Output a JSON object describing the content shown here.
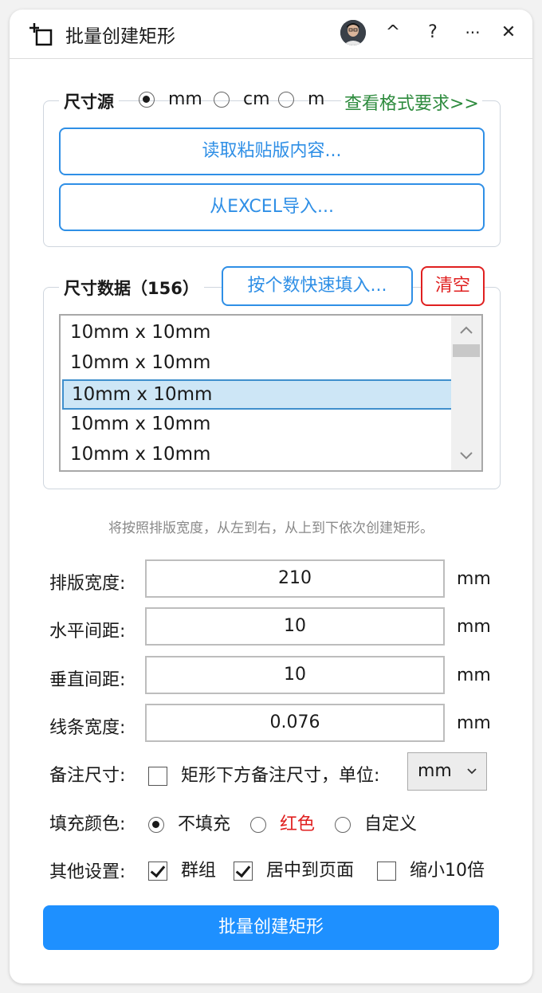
{
  "titlebar": {
    "title": "批量创建矩形",
    "icons": [
      "add-rectangle-icon",
      "user-avatar",
      "collapse-icon",
      "help-icon",
      "more-icon",
      "close-icon"
    ],
    "collapse_glyph": "^",
    "help_glyph": "?",
    "more_glyph": "···",
    "close_glyph": "✕"
  },
  "size_source": {
    "legend": "尺寸源",
    "units": [
      {
        "label": "mm",
        "selected": true
      },
      {
        "label": "cm",
        "selected": false
      },
      {
        "label": "m",
        "selected": false
      }
    ],
    "format_link": "查看格式要求>>",
    "read_clipboard": "读取粘贴版内容...",
    "import_excel": "从EXCEL导入..."
  },
  "size_data": {
    "legend": "尺寸数据（156）",
    "quick_fill": "按个数快速填入...",
    "clear": "清空",
    "items": [
      "10mm x 10mm",
      "10mm x 10mm",
      "10mm x 10mm",
      "10mm x 10mm",
      "10mm x 10mm"
    ],
    "selected_index": 2
  },
  "hint": "将按照排版宽度，从左到右，从上到下依次创建矩形。",
  "layout": {
    "width": {
      "label": "排版宽度:",
      "value": "210",
      "unit": "mm"
    },
    "h_gap": {
      "label": "水平间距:",
      "value": "10",
      "unit": "mm"
    },
    "v_gap": {
      "label": "垂直间距:",
      "value": "10",
      "unit": "mm"
    },
    "line_width": {
      "label": "线条宽度:",
      "value": "0.076",
      "unit": "mm"
    }
  },
  "annotation": {
    "label": "备注尺寸:",
    "checkbox_label": "矩形下方备注尺寸，单位:",
    "checked": false,
    "unit_select": "mm"
  },
  "fill": {
    "label": "填充颜色:",
    "options": [
      {
        "label": "不填充",
        "selected": true
      },
      {
        "label": "红色",
        "selected": false
      },
      {
        "label": "自定义",
        "selected": false
      }
    ],
    "red_color": "#e02020"
  },
  "other": {
    "label": "其他设置:",
    "options": [
      {
        "label": "群组",
        "checked": true
      },
      {
        "label": "居中到页面",
        "checked": true
      },
      {
        "label": "缩小10倍",
        "checked": false
      }
    ]
  },
  "primary_button": "批量创建矩形",
  "colors": {
    "accent": "#1e90ff",
    "link_green": "#2e8b3e",
    "danger": "#e02020"
  }
}
